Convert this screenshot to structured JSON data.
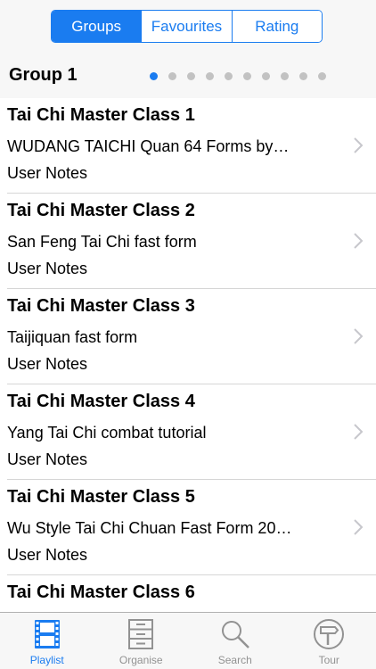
{
  "segments": [
    {
      "label": "Groups",
      "active": true
    },
    {
      "label": "Favourites",
      "active": false
    },
    {
      "label": "Rating",
      "active": false
    }
  ],
  "group": {
    "title": "Group 1",
    "page_count": 10,
    "current_page": 1
  },
  "items": [
    {
      "title": "Tai Chi Master Class 1",
      "subtitle": "WUDANG TAICHI Quan 64 Forms by…",
      "notes": "User Notes"
    },
    {
      "title": "Tai Chi Master Class 2",
      "subtitle": "San Feng Tai Chi fast form",
      "notes": "User Notes"
    },
    {
      "title": "Tai Chi Master Class 3",
      "subtitle": "Taijiquan fast form",
      "notes": "User Notes"
    },
    {
      "title": "Tai Chi Master Class 4",
      "subtitle": "Yang Tai Chi combat tutorial",
      "notes": "User Notes"
    },
    {
      "title": "Tai Chi Master Class 5",
      "subtitle": "Wu Style Tai Chi Chuan Fast Form 20…",
      "notes": "User Notes"
    },
    {
      "title": "Tai Chi Master Class 6",
      "subtitle": "",
      "notes": ""
    }
  ],
  "tabs": [
    {
      "label": "Playlist",
      "icon": "film-strip-icon",
      "active": true
    },
    {
      "label": "Organise",
      "icon": "cabinet-icon",
      "active": false
    },
    {
      "label": "Search",
      "icon": "magnifier-icon",
      "active": false
    },
    {
      "label": "Tour",
      "icon": "signpost-icon",
      "active": false
    }
  ],
  "colors": {
    "accent": "#1a7cf0",
    "inactive": "#929292",
    "dot_inactive": "#c2c2c2"
  }
}
